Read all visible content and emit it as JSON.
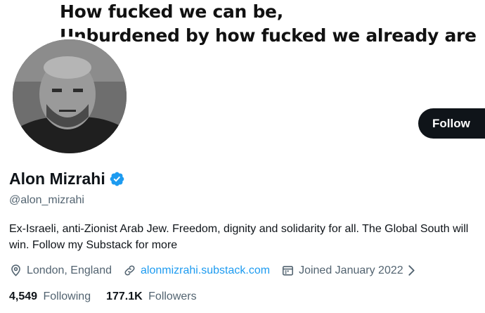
{
  "banner": {
    "line1": "How fucked we can be,",
    "line2": "Unburdened by how fucked we already are"
  },
  "profile": {
    "display_name": "Alon Mizrahi",
    "handle": "@alon_mizrahi",
    "verified": true,
    "bio": "Ex-Israeli, anti-Zionist Arab Jew. Freedom, dignity and solidarity for all. The Global South will win. Follow my Substack for more",
    "location": "London, England",
    "website": "alonmizrahi.substack.com",
    "joined": "Joined January 2022"
  },
  "actions": {
    "follow_label": "Follow"
  },
  "stats": {
    "following_count": "4,549",
    "following_label": "Following",
    "followers_count": "177.1K",
    "followers_label": "Followers"
  },
  "icons": {
    "verified": "verified-badge-icon",
    "location": "location-pin-icon",
    "link": "link-icon",
    "calendar": "calendar-icon",
    "chevron": "chevron-right-icon"
  },
  "colors": {
    "accent": "#1d9bf0",
    "text_primary": "#0f1419",
    "text_secondary": "#536471",
    "button_bg": "#0f1419"
  }
}
